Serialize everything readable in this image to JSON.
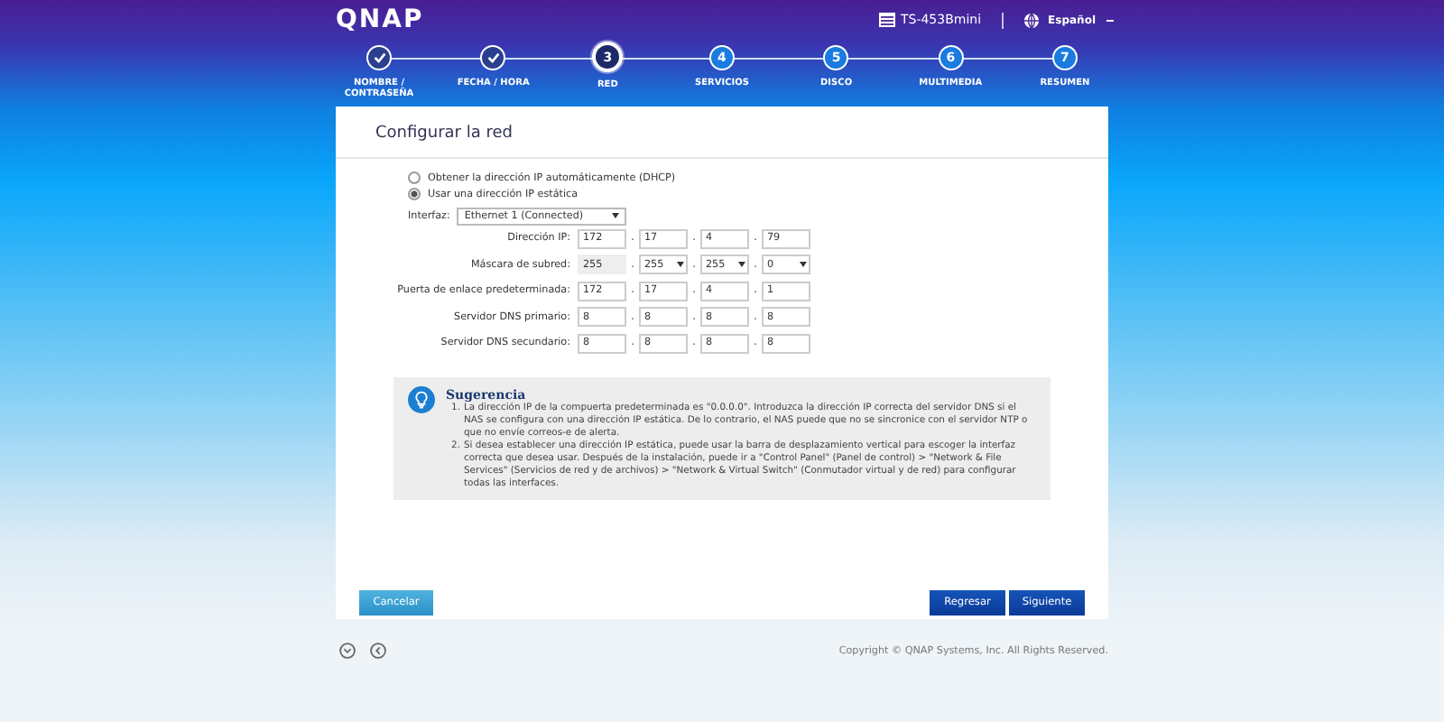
{
  "header": {
    "logo": "QNAP",
    "device": "TS-453Bmini",
    "language": "Español"
  },
  "steps": [
    {
      "label": "NOMBRE / CONTRASEÑA",
      "done": true,
      "selected": false
    },
    {
      "label": "FECHA / HORA",
      "done": true,
      "selected": false
    },
    {
      "number": "3",
      "label": "RED",
      "done": false,
      "selected": true
    },
    {
      "number": "4",
      "label": "SERVICIOS",
      "done": false,
      "selected": false
    },
    {
      "number": "5",
      "label": "DISCO",
      "done": false,
      "selected": false
    },
    {
      "number": "6",
      "label": "MULTIMEDIA",
      "done": false,
      "selected": false
    },
    {
      "number": "7",
      "label": "RESUMEN",
      "done": false,
      "selected": false
    }
  ],
  "card": {
    "title": "Configurar la red",
    "options": [
      {
        "label": "Obtener la dirección IP automáticamente (DHCP)",
        "selected": false
      },
      {
        "label": "Usar una dirección IP estática",
        "selected": true
      }
    ],
    "interface": {
      "label": "Interfaz:",
      "value": "Ethernet 1 (Connected)"
    },
    "rows": [
      {
        "label": "Dirección IP:",
        "fields": [
          {
            "kind": "text",
            "value": "172",
            "disabled": false
          },
          {
            "kind": "text",
            "separator": ".",
            "value": "17",
            "disabled": false
          },
          {
            "kind": "text",
            "separator": ".",
            "value": "4",
            "disabled": false
          },
          {
            "kind": "text",
            "separator": ".",
            "value": "79",
            "disabled": false
          }
        ]
      },
      {
        "label": "Máscara de subred:",
        "fields": [
          {
            "kind": "text",
            "value": "255",
            "disabled": true
          },
          {
            "kind": "select",
            "separator": ".",
            "value": "255",
            "disabled": false
          },
          {
            "kind": "select",
            "separator": ".",
            "value": "255",
            "disabled": false
          },
          {
            "kind": "select",
            "separator": ".",
            "value": "0",
            "disabled": false
          }
        ]
      },
      {
        "label": "Puerta de enlace predeterminada:",
        "fields": [
          {
            "kind": "text",
            "value": "172",
            "disabled": false
          },
          {
            "kind": "text",
            "separator": ".",
            "value": "17",
            "disabled": false
          },
          {
            "kind": "text",
            "separator": ".",
            "value": "4",
            "disabled": false
          },
          {
            "kind": "text",
            "separator": ".",
            "value": "1",
            "disabled": false
          }
        ]
      },
      {
        "label": "Servidor DNS primario:",
        "fields": [
          {
            "kind": "text",
            "value": "8",
            "disabled": false
          },
          {
            "kind": "text",
            "separator": ".",
            "value": "8",
            "disabled": false
          },
          {
            "kind": "text",
            "separator": ".",
            "value": "8",
            "disabled": false
          },
          {
            "kind": "text",
            "separator": ".",
            "value": "8",
            "disabled": false
          }
        ]
      },
      {
        "label": "Servidor DNS secundario:",
        "fields": [
          {
            "kind": "text",
            "value": "8",
            "disabled": false
          },
          {
            "kind": "text",
            "separator": ".",
            "value": "8",
            "disabled": false
          },
          {
            "kind": "text",
            "separator": ".",
            "value": "8",
            "disabled": false
          },
          {
            "kind": "text",
            "separator": ".",
            "value": "8",
            "disabled": false
          }
        ]
      }
    ],
    "hint": {
      "title": "Sugerencia",
      "items": [
        {
          "marker": "1.",
          "text": "La dirección IP de la compuerta predeterminada es \"0.0.0.0\". Introduzca la dirección IP correcta del servidor DNS si el NAS se configura con una dirección IP estática. De lo contrario, el NAS puede que no se sincronice con el servidor NTP o que no envíe correos-e de alerta."
        },
        {
          "marker": "2.",
          "text": "Si desea establecer una dirección IP estática, puede usar la barra de desplazamiento vertical para escoger la interfaz correcta que desea usar. Después de la instalación, puede ir a \"Control Panel\" (Panel de control) > \"Network & File Services\" (Servicios de red y de archivos) > \"Network & Virtual Switch\" (Conmutador virtual y de red) para configurar todas las interfaces."
        }
      ]
    },
    "buttons": [
      {
        "label": "Cancelar",
        "kind": "secondary"
      },
      {
        "label": "Regresar",
        "kind": "primary"
      },
      {
        "label": "Siguiente",
        "kind": "primary"
      }
    ]
  },
  "footer": {
    "copyright": "Copyright © QNAP Systems, Inc. All Rights Reserved."
  }
}
